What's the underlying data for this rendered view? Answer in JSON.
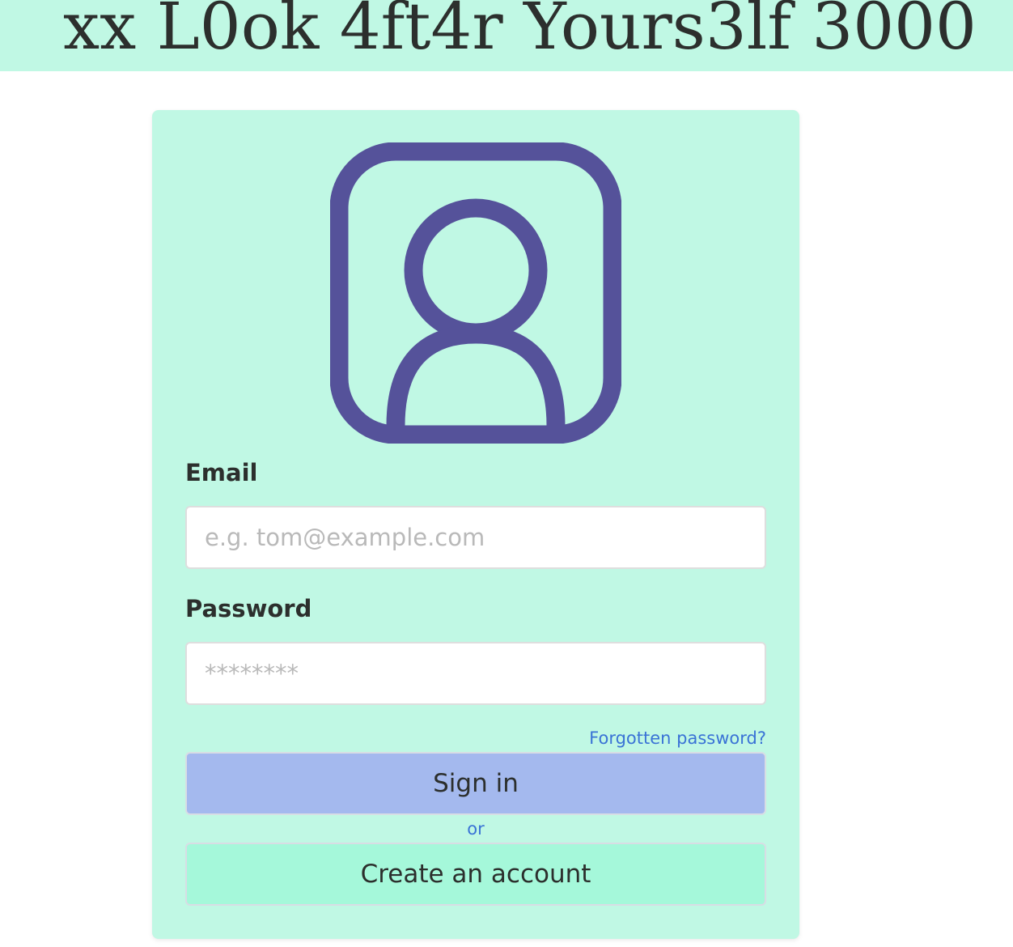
{
  "header": {
    "title": "xx L0ok 4ft4r Yours3lf 3000"
  },
  "login": {
    "avatar_icon": "user-profile-icon",
    "email_label": "Email",
    "email_placeholder": "e.g. tom@example.com",
    "email_value": "",
    "password_label": "Password",
    "password_placeholder": "********",
    "password_value": "",
    "forgot_link": "Forgotten password?",
    "signin_label": "Sign in",
    "or_text": "or",
    "create_label": "Create an account"
  },
  "colors": {
    "brand_mint": "#c0f8e4",
    "icon_purple": "#55529a",
    "signin_blue": "#a4b9ee",
    "create_green": "#a5f8da",
    "link_blue": "#3a73d6"
  }
}
